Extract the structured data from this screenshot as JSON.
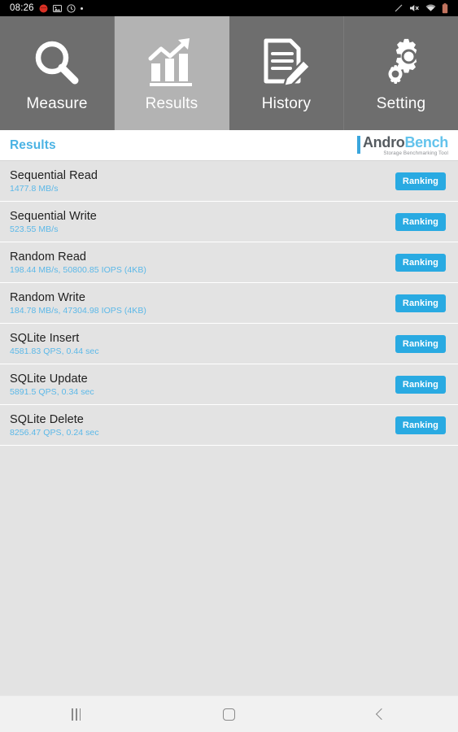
{
  "statusbar": {
    "clock": "08:26",
    "left_icons": [
      "record-red-icon",
      "image-icon",
      "clock-face-icon",
      "dot-icon"
    ],
    "right_icons": [
      "slash-icon",
      "mute-icon",
      "wifi-icon",
      "battery-icon"
    ]
  },
  "tabs": [
    {
      "label": "Measure",
      "icon": "magnifier-icon",
      "active": false
    },
    {
      "label": "Results",
      "icon": "bar-chart-arrow-icon",
      "active": true
    },
    {
      "label": "History",
      "icon": "document-pencil-icon",
      "active": false
    },
    {
      "label": "Setting",
      "icon": "gears-icon",
      "active": false
    }
  ],
  "header": {
    "title": "Results",
    "logo": {
      "word_1": "Andro",
      "word_2": "Bench",
      "tagline": "Storage Benchmarking Tool"
    }
  },
  "results": {
    "ranking_label": "Ranking",
    "rows": [
      {
        "title": "Sequential Read",
        "value": "1477.8 MB/s"
      },
      {
        "title": "Sequential Write",
        "value": "523.55 MB/s"
      },
      {
        "title": "Random Read",
        "value": "198.44 MB/s, 50800.85 IOPS (4KB)"
      },
      {
        "title": "Random Write",
        "value": "184.78 MB/s, 47304.98 IOPS (4KB)"
      },
      {
        "title": "SQLite Insert",
        "value": "4581.83 QPS, 0.44 sec"
      },
      {
        "title": "SQLite Update",
        "value": "5891.5 QPS, 0.34 sec"
      },
      {
        "title": "SQLite Delete",
        "value": "8256.47 QPS, 0.24 sec"
      }
    ]
  },
  "navbar": {
    "recents_label": "Recents",
    "home_label": "Home",
    "back_label": "Back"
  },
  "colors": {
    "accent_blue": "#29aae2",
    "value_blue": "#5bb8e8",
    "tab_inactive": "#6e6e6e",
    "tab_active": "#b3b3b3",
    "row_bg": "#e3e3e3"
  }
}
